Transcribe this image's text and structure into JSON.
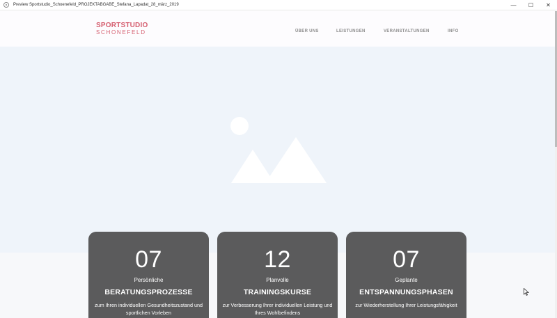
{
  "window": {
    "title": "Preview  Sportstudio_Schoenefeld_PROJEKTABGABE_Stefana_Lapadat_28_märz_2019",
    "controls": [
      "—",
      "☐",
      "✕"
    ]
  },
  "site": {
    "logo_line1": "SPORTSTUDIO",
    "logo_line2": "SCHONEFELD",
    "nav": [
      "ÜBER UNS",
      "LEISTUNGEN",
      "VERANSTALTUNGEN",
      "INFO"
    ],
    "hero": {
      "icon": "image-placeholder-icon"
    },
    "cards": [
      {
        "number": "07",
        "subtitle": "Persönliche",
        "title": "BERATUNGSPROZESSE",
        "description": "zum Ihren individuellen Gesundheitszustand und sportlichen Vorleben"
      },
      {
        "number": "12",
        "subtitle": "Planvolle",
        "title": "TRAININGSKURSE",
        "description": "zur Verbesserung Ihrer individuellen Leistung und Ihres Wohlbefindens"
      },
      {
        "number": "07",
        "subtitle": "Geplante",
        "title": "ENTSPANNUNGSPHASEN",
        "description": "zur Wiederherstellung Ihrer Leistungsfähigkeit"
      }
    ]
  },
  "colors": {
    "brand": "#d55e6f",
    "card_bg": "#5b5b5c",
    "hero_bg": "#eff4fa",
    "nav_text": "#8c8c8c"
  }
}
